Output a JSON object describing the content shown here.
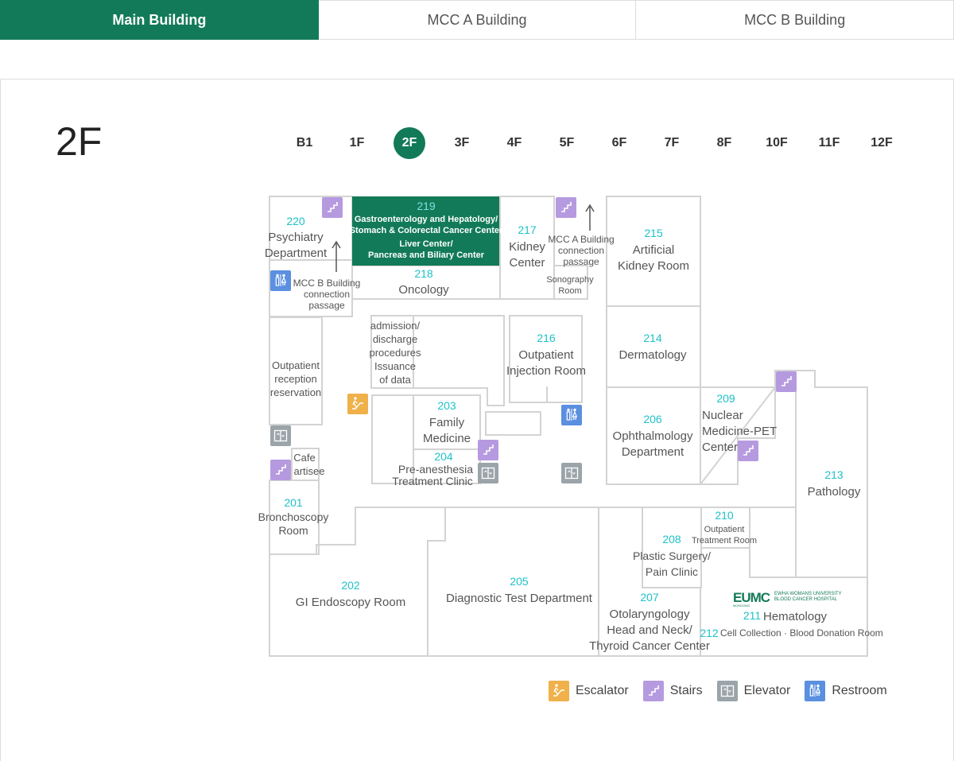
{
  "tabs": [
    {
      "label": "Main Building",
      "active": true
    },
    {
      "label": "MCC A Building",
      "active": false
    },
    {
      "label": "MCC B Building",
      "active": false
    }
  ],
  "floor_title": "2F",
  "floors": [
    "B1",
    "1F",
    "2F",
    "3F",
    "4F",
    "5F",
    "6F",
    "7F",
    "8F",
    "10F",
    "11F",
    "12F"
  ],
  "active_floor": "2F",
  "colors": {
    "brand": "#127a58",
    "highlight_room": "#127a58",
    "room_number": "#1fc2c9",
    "escalator": "#f0b14a",
    "stairs": "#b69ae0",
    "elevator": "#9aa4a9",
    "restroom": "#5b8fe0"
  },
  "map": {
    "rooms": {
      "r220": {
        "num": "220",
        "name1": "Psychiatry",
        "name2": "Department"
      },
      "r219": {
        "num": "219",
        "line1": "Gastroenterology and Hepatology/",
        "line2": "Stomach & Colorectal Cancer Center",
        "line3": "Liver Center/",
        "line4": "Pancreas and Biliary Center"
      },
      "r218": {
        "num": "218",
        "name": "Oncology"
      },
      "r217": {
        "num": "217",
        "name1": "Kidney",
        "name2": "Center"
      },
      "mcc_a": {
        "line1": "MCC A Building",
        "line2": "connection",
        "line3": "passage"
      },
      "sono": {
        "line1": "Sonography",
        "line2": "Room"
      },
      "r215": {
        "num": "215",
        "name1": "Artificial",
        "name2": "Kidney Room"
      },
      "mcc_b": {
        "line1": "MCC B Building",
        "line2": "connection",
        "line3": "passage"
      },
      "admission": {
        "line1": "admission/",
        "line2": "discharge",
        "line3": "procedures",
        "line4": "Issuance",
        "line5": "of data"
      },
      "r216": {
        "num": "216",
        "name1": "Outpatient",
        "name2": "Injection Room"
      },
      "r214": {
        "num": "214",
        "name": "Dermatology"
      },
      "reception": {
        "line1": "Outpatient",
        "line2": "reception",
        "line3": "reservation"
      },
      "r203": {
        "num": "203",
        "name1": "Family",
        "name2": "Medicine"
      },
      "r204": {
        "num": "204",
        "name1": "Pre-anesthesia",
        "name2": "Treatment Clinic"
      },
      "r206": {
        "num": "206",
        "name1": "Ophthalmology",
        "name2": "Department"
      },
      "r209": {
        "num": "209",
        "name1": "Nuclear",
        "name2": "Medicine-PET",
        "name3": "Center"
      },
      "r213": {
        "num": "213",
        "name": "Pathology"
      },
      "cafe": {
        "line1": "Cafe",
        "line2": "artisee"
      },
      "r201": {
        "num": "201",
        "name1": "Bronchoscopy",
        "name2": "Room"
      },
      "r210": {
        "num": "210",
        "name1": "Outpatient",
        "name2": "Treatment Room"
      },
      "r208": {
        "num": "208",
        "name1": "Plastic Surgery/",
        "name2": "Pain Clinic"
      },
      "r202": {
        "num": "202",
        "name": "GI Endoscopy Room"
      },
      "r205": {
        "num": "205",
        "name": "Diagnostic Test Department"
      },
      "r207": {
        "num": "207",
        "name1": "Otolaryngology",
        "name2": "Head and Neck/",
        "name3": "Thyroid Cancer Center"
      },
      "eumc": {
        "logo": "EUMC",
        "sub1": "EWHA WOMANS UNIVERSITY",
        "sub2": "BLOOD CANCER HOSPITAL",
        "sub3": "MOKDONG"
      },
      "r211": {
        "num": "211",
        "name": "Hematology"
      },
      "r212": {
        "num": "212",
        "name": "Cell Collection · Blood Donation Room"
      }
    }
  },
  "legend": [
    {
      "icon": "escalator-icon",
      "label": "Escalator",
      "color": "#f0b14a"
    },
    {
      "icon": "stairs-icon",
      "label": "Stairs",
      "color": "#b69ae0"
    },
    {
      "icon": "elevator-icon",
      "label": "Elevator",
      "color": "#9aa4a9"
    },
    {
      "icon": "restroom-icon",
      "label": "Restroom",
      "color": "#5b8fe0"
    }
  ]
}
